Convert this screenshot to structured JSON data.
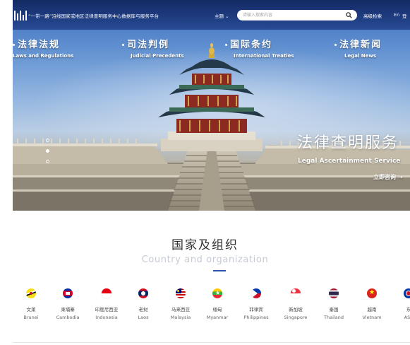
{
  "header": {
    "site_title": "“一带一路”沿线国家或地区法律查明服务中心数据库与服务平台",
    "topic_menu": "主题 ⌄",
    "search_placeholder": "请输入搜索内容",
    "advanced_search": "高级检索",
    "lang_en": "En",
    "lang_cut": "登"
  },
  "nav": [
    {
      "cn": "法律法规",
      "en": "Laws and Regulations"
    },
    {
      "cn": "司法判例",
      "en": "Judicial Precedents"
    },
    {
      "cn": "国际条约",
      "en": "International Treaties"
    },
    {
      "cn": "法律新闻",
      "en": "Legal News"
    }
  ],
  "hero": {
    "title": "法律查明服务",
    "subtitle": "Legal Ascertainment Service",
    "consult": "立即咨询",
    "arrow": "→"
  },
  "section": {
    "title_cn": "国家及组织",
    "title_en": "Country and organization"
  },
  "countries": [
    {
      "cn": "文莱",
      "en": "Brunei",
      "icon": "brunei-flag-icon"
    },
    {
      "cn": "柬埔寨",
      "en": "Cambodia",
      "icon": "cambodia-flag-icon"
    },
    {
      "cn": "印度尼西亚",
      "en": "Indonesia",
      "icon": "indonesia-flag-icon"
    },
    {
      "cn": "老挝",
      "en": "Laos",
      "icon": "laos-flag-icon"
    },
    {
      "cn": "马来西亚",
      "en": "Malaysia",
      "icon": "malaysia-flag-icon"
    },
    {
      "cn": "缅甸",
      "en": "Myanmar",
      "icon": "myanmar-flag-icon"
    },
    {
      "cn": "菲律宾",
      "en": "Philippines",
      "icon": "philippines-flag-icon"
    },
    {
      "cn": "新加坡",
      "en": "Singapore",
      "icon": "singapore-flag-icon"
    },
    {
      "cn": "泰国",
      "en": "Thailand",
      "icon": "thailand-flag-icon"
    },
    {
      "cn": "越南",
      "en": "Vietnam",
      "icon": "vietnam-flag-icon"
    },
    {
      "cn": "东",
      "en": "ASE",
      "icon": "asean-flag-icon"
    }
  ],
  "colors": {
    "nav_bar": "#1f3f8c",
    "accent_line": "#2355a6",
    "subtitle_grey": "#c6cbd3"
  }
}
